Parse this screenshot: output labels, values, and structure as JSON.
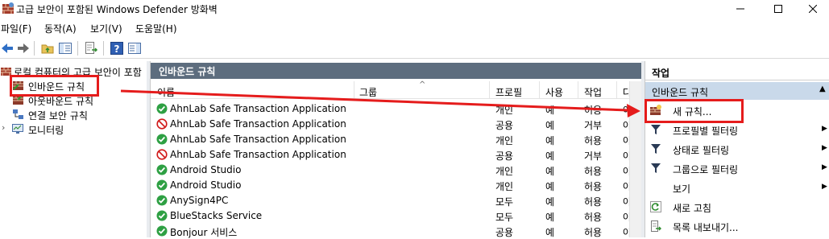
{
  "window": {
    "title": "고급 보안이 포함된 Windows Defender 방화벽",
    "minimize": "—",
    "maximize": "☐",
    "close": "✕"
  },
  "menu": [
    "파일(F)",
    "동작(A)",
    "보기(V)",
    "도움말(H)"
  ],
  "tree": {
    "root": "로컬 컴퓨터의 고급 보안이 포함",
    "items": [
      "인바운드 규칙",
      "아웃바운드 규칙",
      "연결 보안 규칙",
      "모니터링"
    ]
  },
  "center": {
    "title": "인바운드 규칙",
    "columns": [
      "이름",
      "그룹",
      "프로필",
      "사용",
      "작업",
      "다"
    ],
    "rows": [
      {
        "name": "AhnLab Safe Transaction Application",
        "group": "",
        "profile": "개인",
        "enabled": "예",
        "action": "허용",
        "over": "아",
        "status": "allow"
      },
      {
        "name": "AhnLab Safe Transaction Application",
        "group": "",
        "profile": "공용",
        "enabled": "예",
        "action": "거부",
        "over": "아",
        "status": "block"
      },
      {
        "name": "AhnLab Safe Transaction Application",
        "group": "",
        "profile": "개인",
        "enabled": "예",
        "action": "허용",
        "over": "아",
        "status": "allow"
      },
      {
        "name": "AhnLab Safe Transaction Application",
        "group": "",
        "profile": "공용",
        "enabled": "예",
        "action": "거부",
        "over": "아",
        "status": "block"
      },
      {
        "name": "Android Studio",
        "group": "",
        "profile": "개인",
        "enabled": "예",
        "action": "허용",
        "over": "아",
        "status": "allow"
      },
      {
        "name": "Android Studio",
        "group": "",
        "profile": "개인",
        "enabled": "예",
        "action": "허용",
        "over": "아",
        "status": "allow"
      },
      {
        "name": "AnySign4PC",
        "group": "",
        "profile": "모두",
        "enabled": "예",
        "action": "허용",
        "over": "아",
        "status": "allow"
      },
      {
        "name": "BlueStacks Service",
        "group": "",
        "profile": "모두",
        "enabled": "예",
        "action": "허용",
        "over": "아",
        "status": "allow"
      },
      {
        "name": "Bonjour 서비스",
        "group": "",
        "profile": "공용",
        "enabled": "예",
        "action": "허용",
        "over": "아",
        "status": "allow"
      }
    ]
  },
  "actions": {
    "header": "작업",
    "section": "인바운드 규칙",
    "items": [
      "새 규칙...",
      "프로필별 필터링",
      "상태로 필터링",
      "그룹으로 필터링",
      "보기",
      "새로 고침",
      "목록 내보내기..."
    ]
  },
  "colors": {
    "panel_title_bg": "#5d6d7e",
    "selection_bg": "#c9d9ea",
    "annotation_red": "#e51c1c",
    "allow_green": "#2ea043",
    "block_red": "#d11a1a"
  }
}
